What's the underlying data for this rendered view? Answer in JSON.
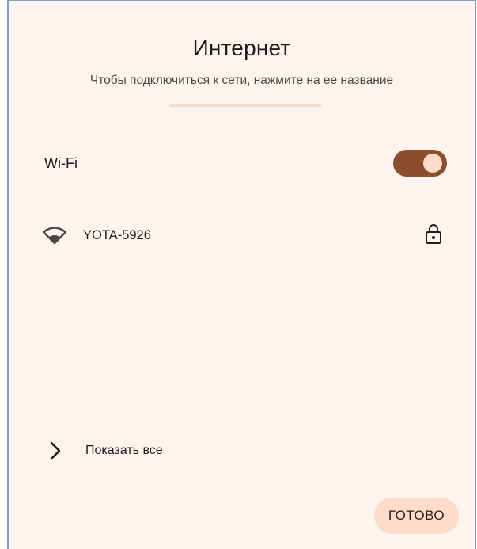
{
  "dialog": {
    "title": "Интернет",
    "subtitle": "Чтобы подключиться к сети, нажмите на ее название"
  },
  "wifi": {
    "label": "Wi-Fi",
    "enabled": true
  },
  "networks": [
    {
      "name": "YOTA-5926",
      "secured": true,
      "icon": "wifi-signal-icon",
      "lock_icon": "lock-icon"
    }
  ],
  "show_all": {
    "label": "Показать все",
    "icon": "chevron-right-icon"
  },
  "actions": {
    "done_label": "ГОТОВО"
  },
  "colors": {
    "background": "#fdf3ef",
    "accent": "#8b4f2e",
    "accent_light": "#ffdbca",
    "divider": "#f1dcd2",
    "text_primary": "#221a17",
    "text_secondary": "#4f4542"
  }
}
